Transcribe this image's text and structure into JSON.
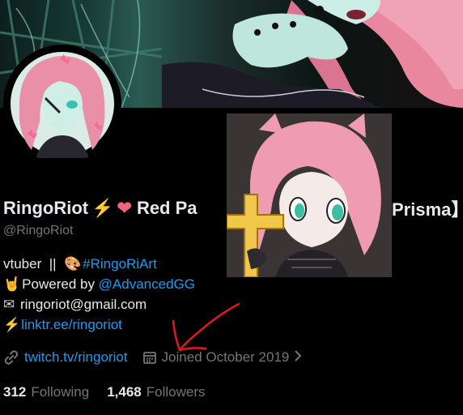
{
  "profile": {
    "display_name": "RingoRiot",
    "name_emoji_1": "⚡",
    "name_emoji_2": "❤",
    "name_fragment_left": "Red Pa",
    "name_fragment_right": "Prisma】",
    "handle": "@RingoRiot"
  },
  "bio": {
    "line1_text": "vtuber  ||  ",
    "line1_emoji": "🎨",
    "line1_link": "#RingoRiArt",
    "line2_emoji": "🤘",
    "line2_text": "Powered by ",
    "line2_link": "@AdvancedGG",
    "line3_emoji": "✉",
    "line3_text": " ringoriot@gmail.com",
    "line4_emoji": "⚡",
    "line4_link": "linktr.ee/ringoriot"
  },
  "meta": {
    "website": "twitch.tv/ringoriot",
    "joined": "Joined October 2019",
    "link_icon": "link-icon",
    "calendar_icon": "calendar-icon"
  },
  "counts": {
    "following_count": "312",
    "following_label": "Following",
    "followers_count": "1,468",
    "followers_label": "Followers"
  },
  "colors": {
    "background": "#000000",
    "text": "#e7e9ea",
    "muted": "#71767b",
    "link": "#1d9bf0",
    "annotation_arrow": "#e0191c"
  }
}
